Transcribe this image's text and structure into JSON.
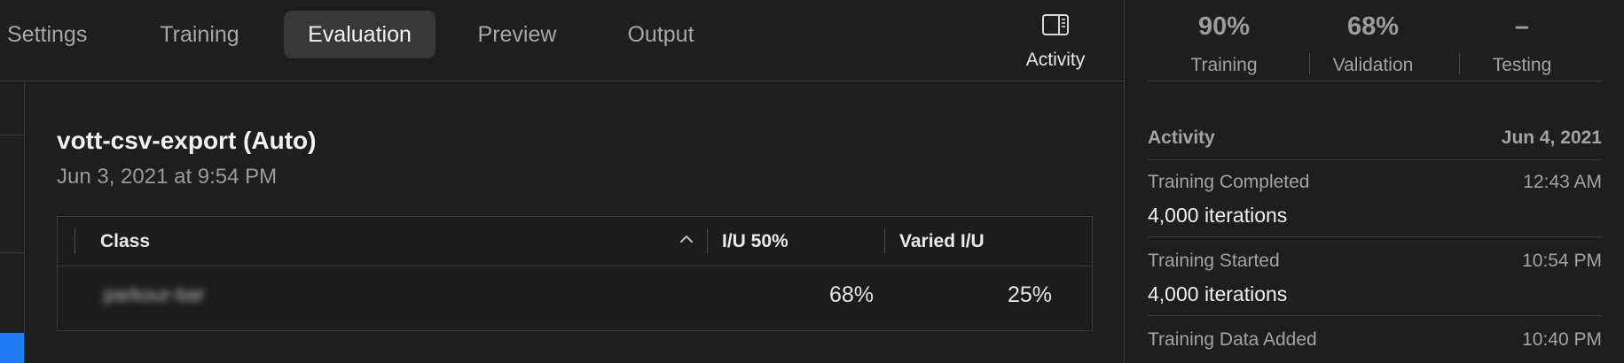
{
  "toolbar": {
    "tabs": [
      {
        "label": "Settings"
      },
      {
        "label": "Training"
      },
      {
        "label": "Evaluation",
        "active": true
      },
      {
        "label": "Preview"
      },
      {
        "label": "Output"
      }
    ],
    "activity_button": {
      "label": "Activity",
      "icon": "sidebar-toggle-icon"
    }
  },
  "main": {
    "model_title": "vott-csv-export (Auto)",
    "model_date": "Jun 3, 2021 at 9:54 PM",
    "table": {
      "columns": [
        "Class",
        "I/U 50%",
        "Varied I/U"
      ],
      "sort_icon": "chevron-up-icon",
      "rows": [
        {
          "class": "parkour-bar",
          "iu50": "68%",
          "varied_iu": "25%"
        }
      ]
    }
  },
  "inspector": {
    "stats": [
      {
        "value": "90%",
        "label": "Training"
      },
      {
        "value": "68%",
        "label": "Validation"
      },
      {
        "value": "–",
        "label": "Testing"
      }
    ],
    "activity": {
      "title": "Activity",
      "date": "Jun 4, 2021",
      "items": [
        {
          "title": "Training Completed",
          "time": "12:43 AM",
          "detail": "4,000 iterations"
        },
        {
          "title": "Training Started",
          "time": "10:54 PM",
          "detail": "4,000 iterations"
        },
        {
          "title": "Training Data Added",
          "time": "10:40 PM",
          "detail": ""
        }
      ]
    }
  },
  "colors": {
    "background": "#1e1e1e",
    "active_tab": "#383838",
    "accent": "#1f7cf3",
    "divider": "#3a3a3a"
  }
}
